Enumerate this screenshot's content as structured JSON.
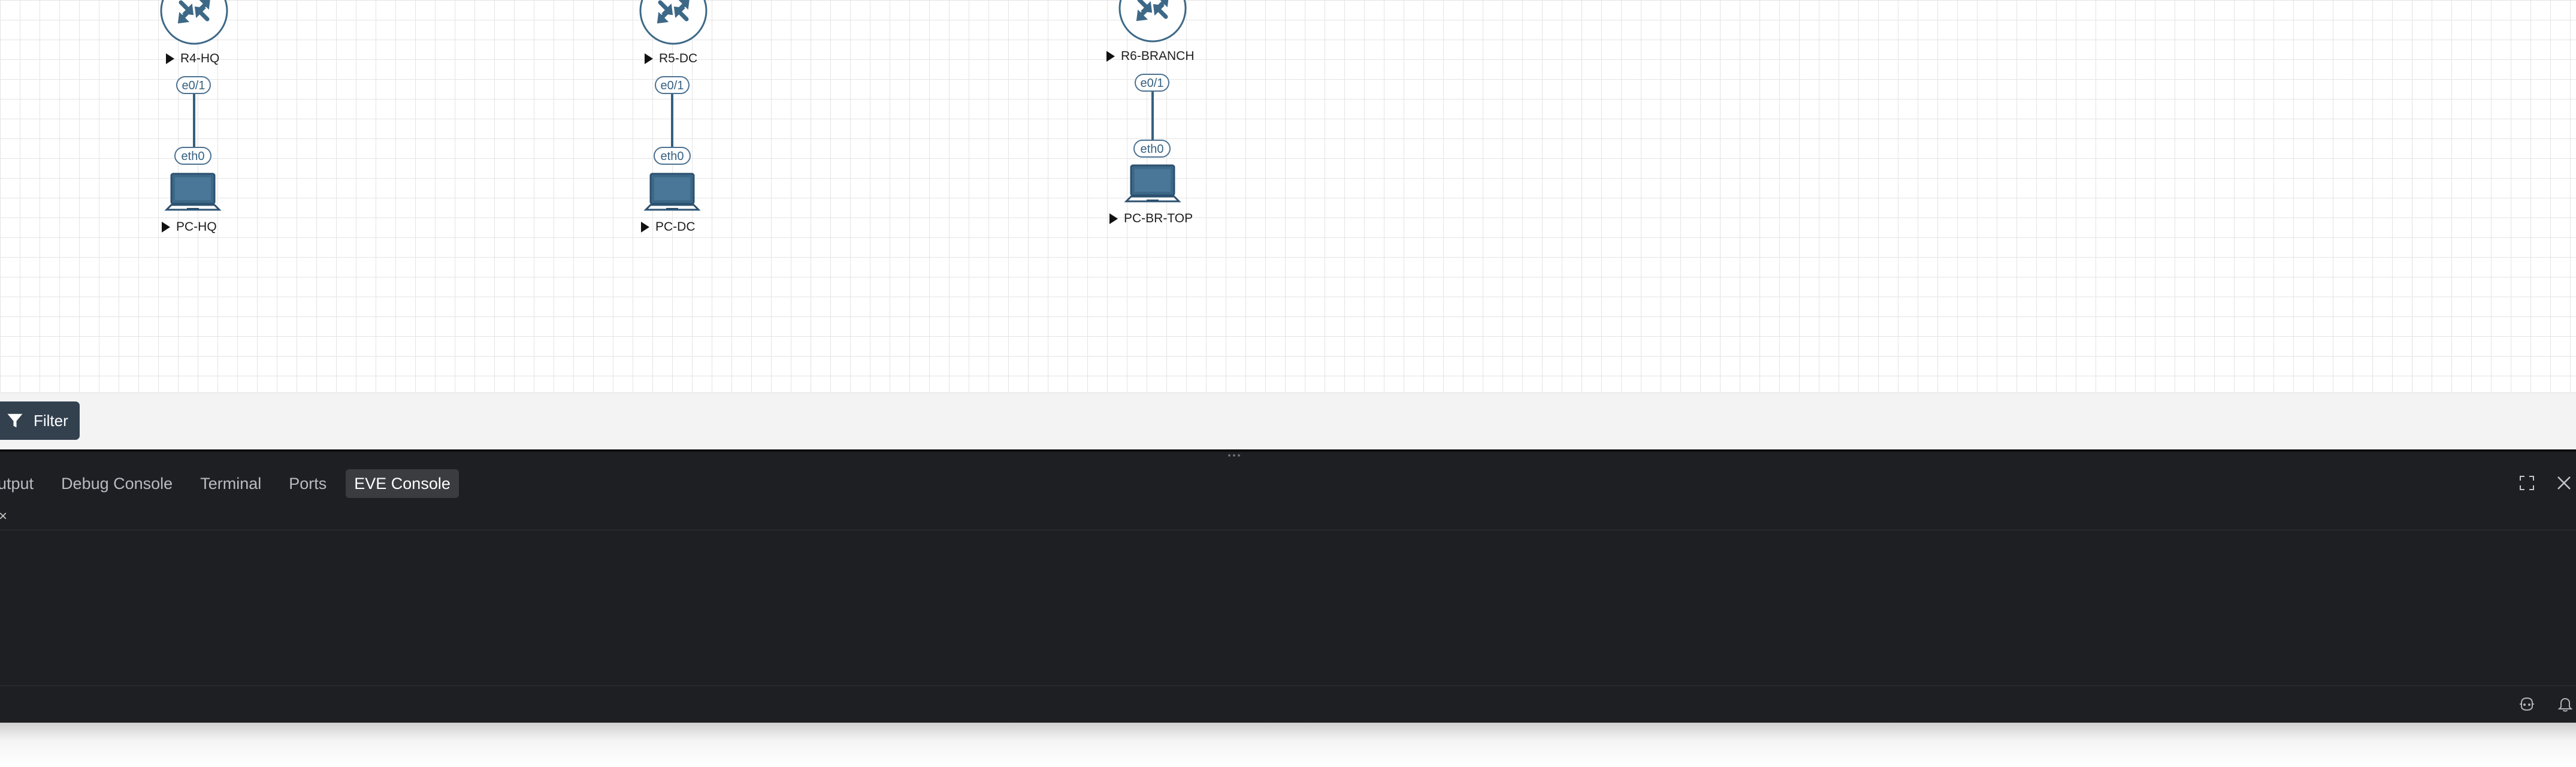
{
  "topology": {
    "nodes": [
      {
        "id": "r4",
        "type": "router",
        "label": "R4-HQ"
      },
      {
        "id": "r5",
        "type": "router",
        "label": "R5-DC"
      },
      {
        "id": "r6",
        "type": "router",
        "label": "R6-BRANCH"
      },
      {
        "id": "pc_hq",
        "type": "pc",
        "label": "PC-HQ"
      },
      {
        "id": "pc_dc",
        "type": "pc",
        "label": "PC-DC"
      },
      {
        "id": "pc_br",
        "type": "pc",
        "label": "PC-BR-TOP"
      }
    ],
    "links": [
      {
        "from": "R4-HQ",
        "from_if": "e0/1",
        "to": "PC-HQ",
        "to_if": "eth0"
      },
      {
        "from": "R5-DC",
        "from_if": "e0/1",
        "to": "PC-DC",
        "to_if": "eth0"
      },
      {
        "from": "R6-BRANCH",
        "from_if": "e0/1",
        "to": "PC-BR-TOP",
        "to_if": "eth0"
      }
    ]
  },
  "toolbar": {
    "filter_label": "Filter",
    "filter_icon": "funnel-icon"
  },
  "panel": {
    "tabs": [
      {
        "label": "utput",
        "active": false
      },
      {
        "label": "Debug Console",
        "active": false
      },
      {
        "label": "Terminal",
        "active": false
      },
      {
        "label": "Ports",
        "active": false
      },
      {
        "label": "EVE Console",
        "active": true
      }
    ],
    "close_glyph": "×",
    "actions": [
      "maximize-icon",
      "close-icon"
    ],
    "status_icons": [
      "copilot-icon",
      "bell-icon"
    ]
  },
  "colors": {
    "canvas_bg": "#ffffff",
    "grid_line": "#e4e4e4",
    "link": "#35607f",
    "router_icon": "#3d6887",
    "panel_bg": "#1e1f22",
    "active_tab_bg": "#3a3c40",
    "filter_bg": "#33414f"
  }
}
